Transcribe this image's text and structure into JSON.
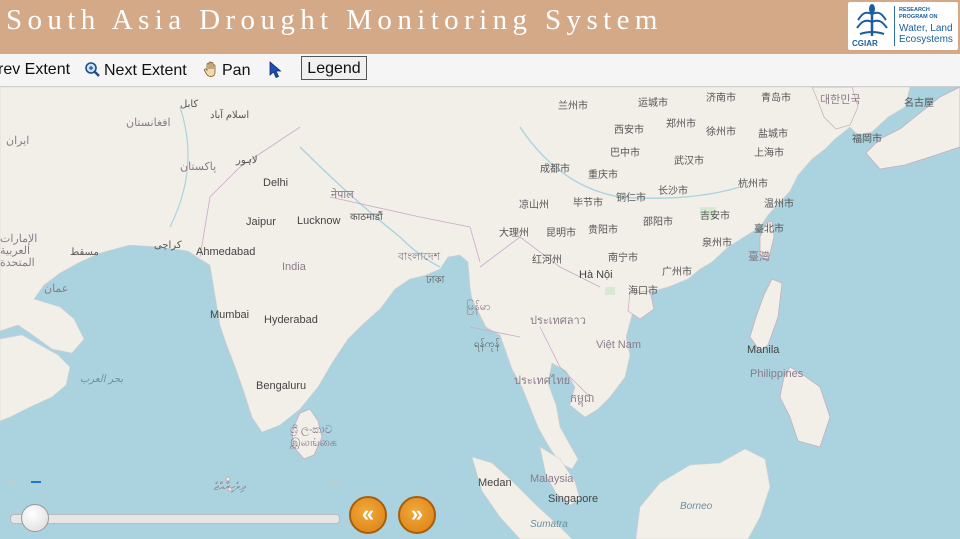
{
  "header": {
    "title": "South Asia Drought Monitoring System",
    "logo": {
      "org": "CGIAR",
      "line1": "RESEARCH PROGRAM ON",
      "line2": "Water, Land Ecosystems"
    }
  },
  "toolbar": {
    "prev_extent": "rev Extent",
    "next_extent": "Next Extent",
    "pan": "Pan",
    "legend": "Legend",
    "icons": [
      "zoom-extent-icon",
      "hand-pan-icon",
      "arrow-pointer-icon"
    ]
  },
  "map": {
    "labels": [
      {
        "text": "كابل",
        "cls": "lbl"
      },
      {
        "text": "اسلام آباد",
        "cls": "lbl"
      },
      {
        "text": "افغانستان",
        "cls": "lbl country"
      },
      {
        "text": "ایران",
        "cls": "lbl country"
      },
      {
        "text": "پاکستان",
        "cls": "lbl country"
      },
      {
        "text": "لاہور",
        "cls": "lbl"
      },
      {
        "text": "Delhi",
        "cls": "lbl city"
      },
      {
        "text": "नेपाल",
        "cls": "lbl country"
      },
      {
        "text": "काठमाडौं",
        "cls": "lbl"
      },
      {
        "text": "Jaipur",
        "cls": "lbl city"
      },
      {
        "text": "Lucknow",
        "cls": "lbl city"
      },
      {
        "text": "الإمارات العربية المتحدة",
        "cls": "lbl country"
      },
      {
        "text": "مسقط",
        "cls": "lbl"
      },
      {
        "text": "كراچی",
        "cls": "lbl"
      },
      {
        "text": "Ahmedabad",
        "cls": "lbl city"
      },
      {
        "text": "India",
        "cls": "lbl country"
      },
      {
        "text": "عمان",
        "cls": "lbl country"
      },
      {
        "text": "Mumbai",
        "cls": "lbl city"
      },
      {
        "text": "Hyderabad",
        "cls": "lbl city"
      },
      {
        "text": "بحر العرب",
        "cls": "lbl sea"
      },
      {
        "text": "Bengaluru",
        "cls": "lbl city"
      },
      {
        "text": "ශ්‍රී ලංකාව",
        "cls": "lbl country"
      },
      {
        "text": "இலங்கை",
        "cls": "lbl country"
      },
      {
        "text": "বাংলাদেশ",
        "cls": "lbl country"
      },
      {
        "text": "ঢাকা",
        "cls": "lbl"
      },
      {
        "text": "မြန်မာ",
        "cls": "lbl country"
      },
      {
        "text": "ရန်ကုန်",
        "cls": "lbl"
      },
      {
        "text": "兰州市",
        "cls": "lbl"
      },
      {
        "text": "运城市",
        "cls": "lbl"
      },
      {
        "text": "济南市",
        "cls": "lbl"
      },
      {
        "text": "青岛市",
        "cls": "lbl"
      },
      {
        "text": "대한민국",
        "cls": "lbl country"
      },
      {
        "text": "名古屋",
        "cls": "lbl"
      },
      {
        "text": "西安市",
        "cls": "lbl"
      },
      {
        "text": "郑州市",
        "cls": "lbl"
      },
      {
        "text": "徐州市",
        "cls": "lbl"
      },
      {
        "text": "盐城市",
        "cls": "lbl"
      },
      {
        "text": "福岡市",
        "cls": "lbl"
      },
      {
        "text": "巴中市",
        "cls": "lbl"
      },
      {
        "text": "上海市",
        "cls": "lbl"
      },
      {
        "text": "成都市",
        "cls": "lbl"
      },
      {
        "text": "重庆市",
        "cls": "lbl"
      },
      {
        "text": "武汉市",
        "cls": "lbl"
      },
      {
        "text": "杭州市",
        "cls": "lbl"
      },
      {
        "text": "铜仁市",
        "cls": "lbl"
      },
      {
        "text": "长沙市",
        "cls": "lbl"
      },
      {
        "text": "凉山州",
        "cls": "lbl"
      },
      {
        "text": "毕节市",
        "cls": "lbl"
      },
      {
        "text": "温州市",
        "cls": "lbl"
      },
      {
        "text": "大理州",
        "cls": "lbl"
      },
      {
        "text": "昆明市",
        "cls": "lbl"
      },
      {
        "text": "贵阳市",
        "cls": "lbl"
      },
      {
        "text": "邵阳市",
        "cls": "lbl"
      },
      {
        "text": "吉安市",
        "cls": "lbl"
      },
      {
        "text": "臺北市",
        "cls": "lbl"
      },
      {
        "text": "泉州市",
        "cls": "lbl"
      },
      {
        "text": "臺灣",
        "cls": "lbl country"
      },
      {
        "text": "红河州",
        "cls": "lbl"
      },
      {
        "text": "南宁市",
        "cls": "lbl"
      },
      {
        "text": "广州市",
        "cls": "lbl"
      },
      {
        "text": "Hà Nội",
        "cls": "lbl city"
      },
      {
        "text": "海口市",
        "cls": "lbl"
      },
      {
        "text": "ประเทศลาว",
        "cls": "lbl country"
      },
      {
        "text": "Việt Nam",
        "cls": "lbl country"
      },
      {
        "text": "Manila",
        "cls": "lbl city"
      },
      {
        "text": "ประเทศไทย",
        "cls": "lbl country"
      },
      {
        "text": "Philippines",
        "cls": "lbl country"
      },
      {
        "text": "កម្ពុជា",
        "cls": "lbl country"
      },
      {
        "text": "ދިވެހިރާއްޖެ",
        "cls": "lbl country"
      },
      {
        "text": "Medan",
        "cls": "lbl city"
      },
      {
        "text": "Malaysia",
        "cls": "lbl country"
      },
      {
        "text": "Singapore",
        "cls": "lbl city"
      },
      {
        "text": "Borneo",
        "cls": "lbl sea"
      },
      {
        "text": "Sumatra",
        "cls": "lbl sea"
      }
    ]
  },
  "time_slider": {
    "prev_label": "«",
    "next_label": "»"
  },
  "colors": {
    "header": "#d4a987",
    "water": "#aad3df",
    "land": "#f2efe9",
    "nav_button": "#e8951f"
  }
}
